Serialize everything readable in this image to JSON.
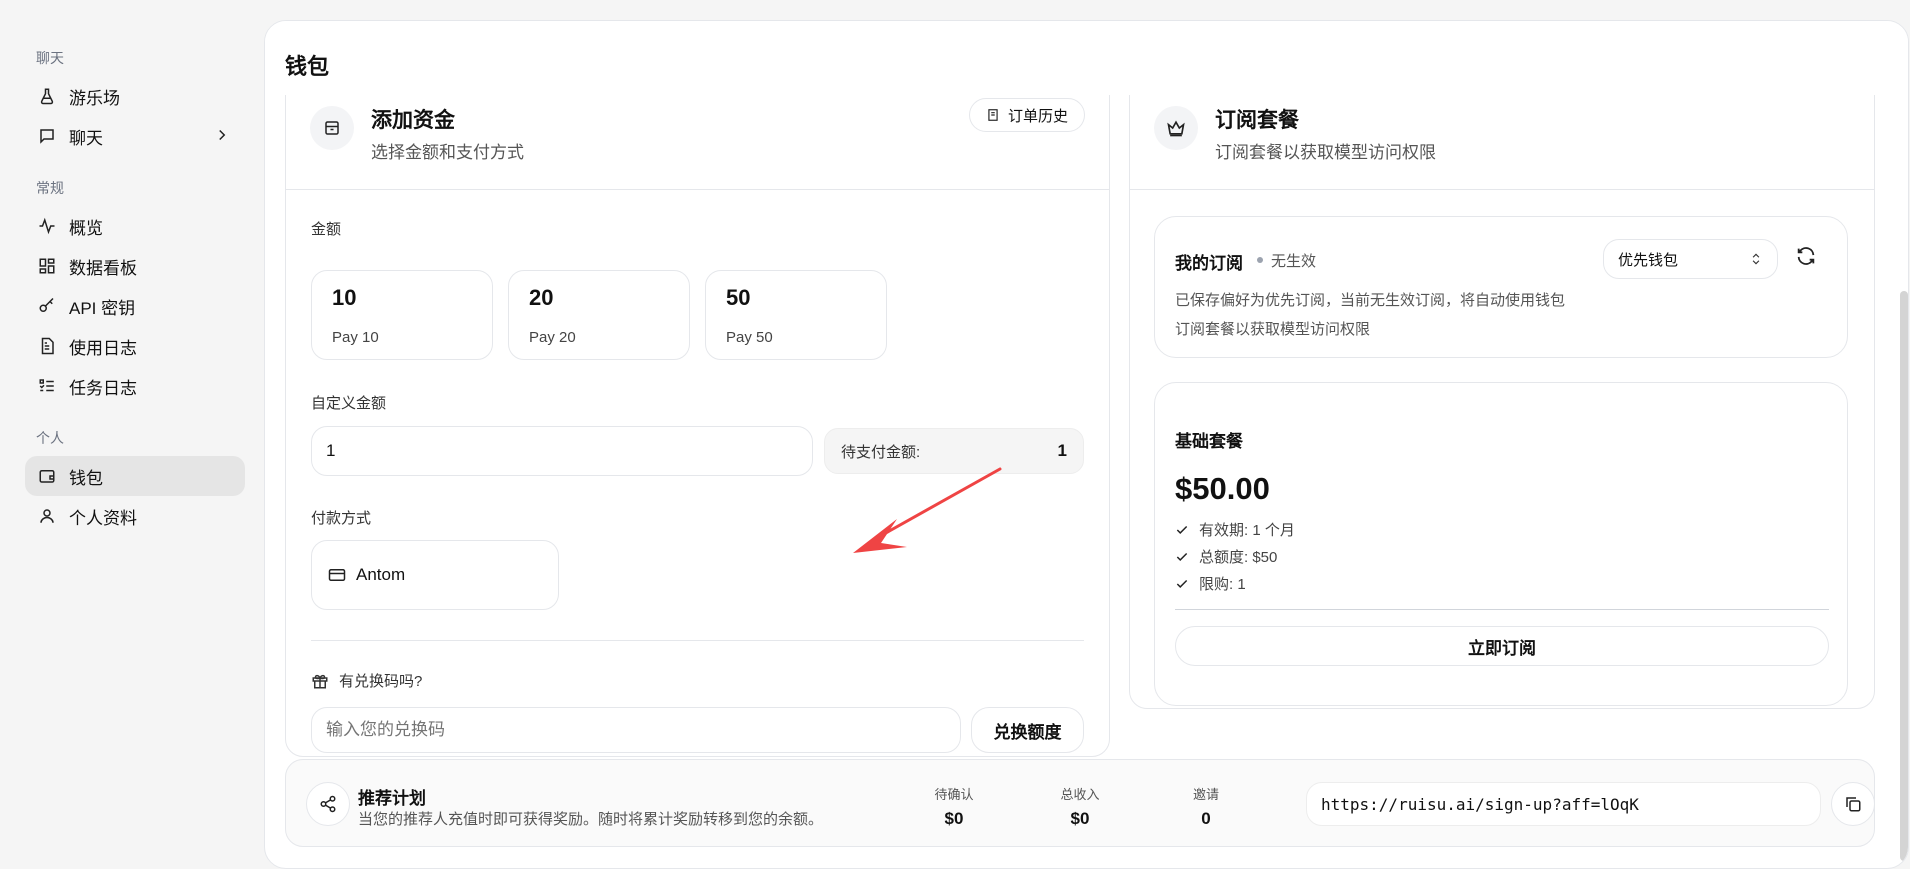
{
  "sidebar": {
    "sections": [
      {
        "label": "聊天",
        "items": [
          {
            "label": "游乐场",
            "icon": "flask-icon"
          },
          {
            "label": "聊天",
            "icon": "message-icon"
          }
        ]
      },
      {
        "label": "常规",
        "items": [
          {
            "label": "概览",
            "icon": "activity-icon"
          },
          {
            "label": "数据看板",
            "icon": "dashboard-icon"
          },
          {
            "label": "API 密钥",
            "icon": "key-icon"
          },
          {
            "label": "使用日志",
            "icon": "file-icon"
          },
          {
            "label": "任务日志",
            "icon": "list-check-icon"
          }
        ]
      },
      {
        "label": "个人",
        "items": [
          {
            "label": "钱包",
            "icon": "wallet-icon",
            "active": true
          },
          {
            "label": "个人资料",
            "icon": "user-icon"
          }
        ]
      }
    ]
  },
  "page": {
    "title": "钱包"
  },
  "topup": {
    "title": "添加资金",
    "subtitle": "选择金额和支付方式",
    "order_history_label": "订单历史",
    "amount_label": "金额",
    "amounts": [
      {
        "value": "10",
        "sub": "Pay 10"
      },
      {
        "value": "20",
        "sub": "Pay 20"
      },
      {
        "value": "50",
        "sub": "Pay 50"
      }
    ],
    "custom_label": "自定义金额",
    "custom_value": "1",
    "due_label": "待支付金额:",
    "due_value": "1",
    "payment_label": "付款方式",
    "payment_method": "Antom",
    "redeem_question": "有兑换码吗?",
    "redeem_placeholder": "输入您的兑换码",
    "redeem_button": "兑换额度"
  },
  "subscription": {
    "title": "订阅套餐",
    "subtitle": "订阅套餐以获取模型访问权限",
    "my": {
      "title": "我的订阅",
      "status": "无生效",
      "line1": "已保存偏好为优先订阅，当前无生效订阅，将自动使用钱包",
      "line2": "订阅套餐以获取模型访问权限",
      "select_value": "优先钱包"
    },
    "plan": {
      "name": "基础套餐",
      "price": "$50.00",
      "features": [
        "有效期: 1 个月",
        "总额度: $50",
        "限购: 1"
      ],
      "button": "立即订阅"
    }
  },
  "referral": {
    "title": "推荐计划",
    "subtitle": "当您的推荐人充值时即可获得奖励。随时将累计奖励转移到您的余额。",
    "stats": [
      {
        "label": "待确认",
        "value": "$0"
      },
      {
        "label": "总收入",
        "value": "$0"
      },
      {
        "label": "邀请",
        "value": "0"
      }
    ],
    "link": "https://ruisu.ai/sign-up?aff=lOqK"
  },
  "colors": {
    "accent_arrow": "#ef4444",
    "active_bg": "#e5e5e5"
  }
}
